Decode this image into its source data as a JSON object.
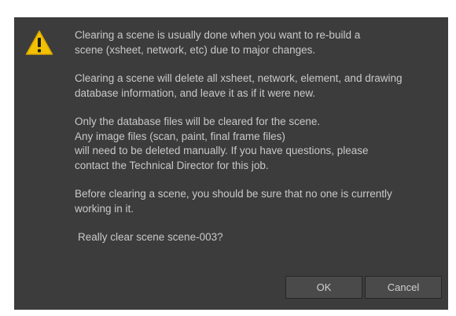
{
  "dialog": {
    "icon": "warning-icon",
    "messages": [
      "Clearing a scene is usually done when you want to re-build a\nscene (xsheet, network, etc) due to major changes.",
      "Clearing a scene will delete all xsheet, network, element, and drawing\ndatabase information, and leave it as if it were new.",
      "Only the database files will be cleared for the scene.\nAny image files (scan, paint, final frame files)\nwill need to be deleted manually.  If you have questions, please\ncontact the Technical Director for this job.",
      "Before clearing a scene, you should be sure that no one is currently\nworking in it."
    ],
    "confirm": "Really clear scene scene-003?",
    "ok_label": "OK",
    "cancel_label": "Cancel"
  },
  "colors": {
    "dialog_bg": "#3c3c3c",
    "text": "#c9c9c9",
    "warning_yellow": "#f2c200"
  }
}
